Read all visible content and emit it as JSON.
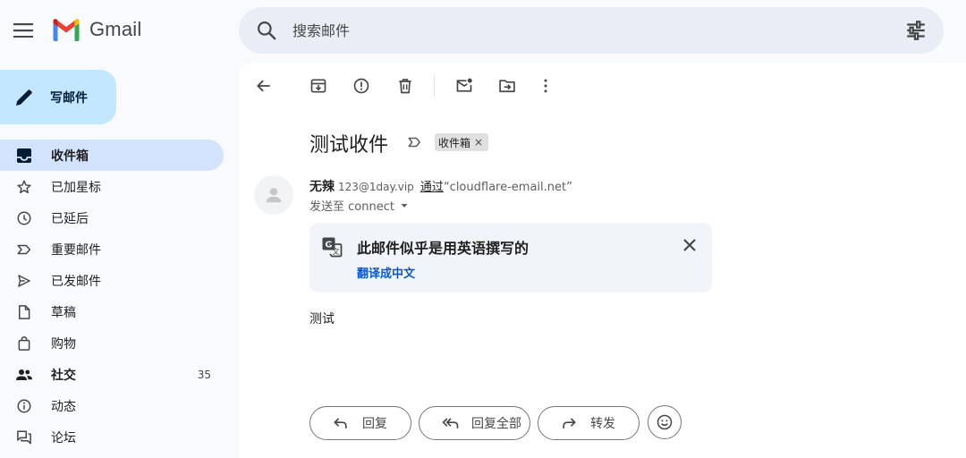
{
  "header": {
    "app_name": "Gmail",
    "search_placeholder": "搜索邮件"
  },
  "compose": {
    "label": "写邮件"
  },
  "sidebar": {
    "items": [
      {
        "label": "收件箱",
        "icon": "inbox-icon",
        "active": true
      },
      {
        "label": "已加星标",
        "icon": "star-icon"
      },
      {
        "label": "已延后",
        "icon": "clock-icon"
      },
      {
        "label": "重要邮件",
        "icon": "important-icon"
      },
      {
        "label": "已发邮件",
        "icon": "send-icon"
      },
      {
        "label": "草稿",
        "icon": "draft-icon"
      },
      {
        "label": "购物",
        "icon": "shopping-bag-icon"
      },
      {
        "label": "社交",
        "icon": "people-icon",
        "count": "35"
      },
      {
        "label": "动态",
        "icon": "info-icon"
      },
      {
        "label": "论坛",
        "icon": "forum-icon"
      }
    ]
  },
  "toolbar": {
    "icons": [
      "back-arrow-icon",
      "archive-icon",
      "report-spam-icon",
      "delete-icon",
      "mark-unread-icon",
      "move-to-icon",
      "more-vert-icon"
    ]
  },
  "message": {
    "subject": "测试收件",
    "label_chip": "收件箱",
    "label_chip_close": "×",
    "sender_name": "无辣",
    "sender_email": "123@1day.vip",
    "via_label": "通过",
    "via_domain": "“cloudflare-email.net”",
    "to_line": "发送至 connect",
    "translate": {
      "title": "此邮件似乎是用英语撰写的",
      "link": "翻译成中文"
    },
    "body": "测试"
  },
  "actions": {
    "reply": "回复",
    "reply_all": "回复全部",
    "forward": "转发"
  },
  "colors": {
    "compose_bg": "#c2e7ff",
    "active_nav_bg": "#d3e3fd",
    "search_bg": "#e9eef6",
    "link_blue": "#0b57d0"
  }
}
